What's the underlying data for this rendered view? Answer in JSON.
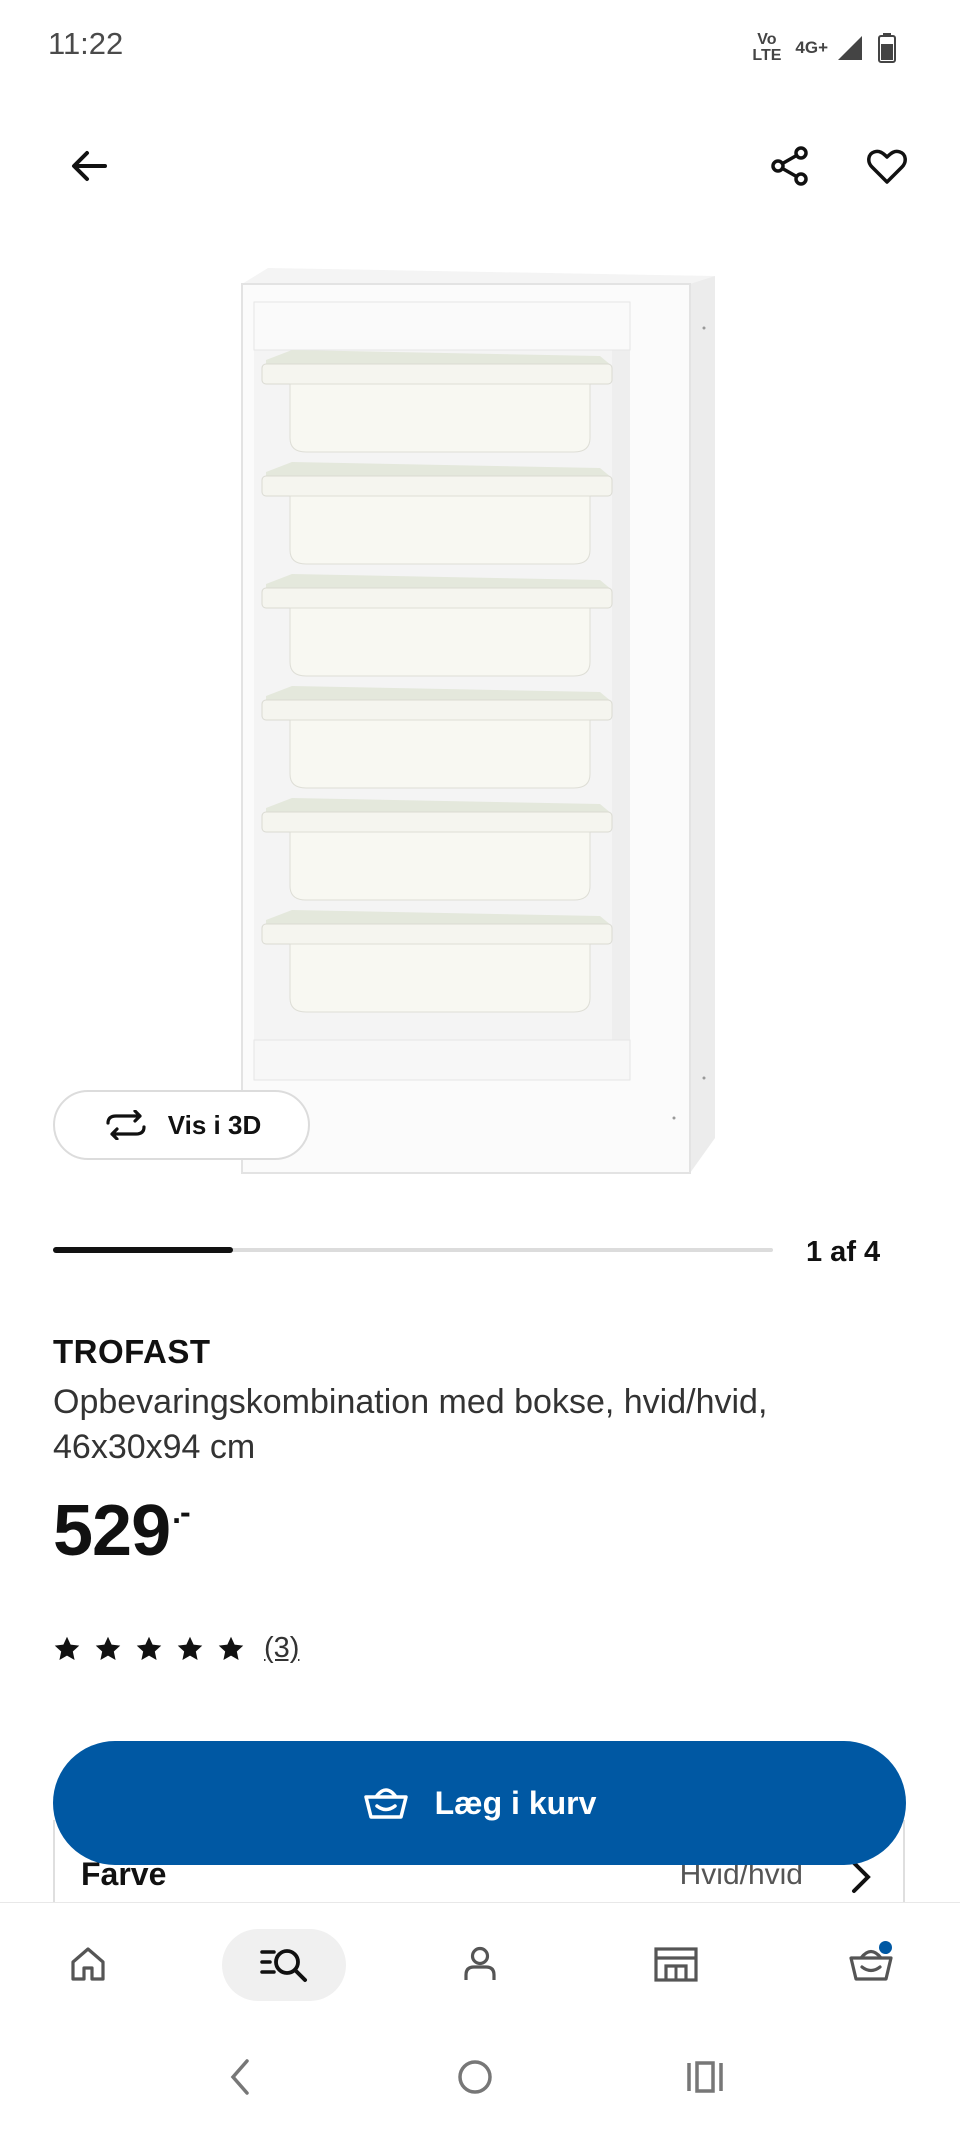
{
  "status_bar": {
    "time": "11:22",
    "volte_top": "Vo",
    "volte_bottom": "LTE",
    "network": "4G+"
  },
  "top_bar": {
    "back_icon": "arrow-left-icon",
    "share_icon": "share-icon",
    "favourite_icon": "heart-icon"
  },
  "gallery": {
    "view_3d_label": "Vis i 3D",
    "counter": "1 af 4",
    "current": 1,
    "total": 4
  },
  "product": {
    "name": "TROFAST",
    "description": "Opbevaringskombination med bokse, hvid/hvid, 46x30x94 cm",
    "price": "529",
    "price_suffix": ".-",
    "rating": 5,
    "review_count": "(3)"
  },
  "variant": {
    "label": "Farve",
    "value": "Hvid/hvid"
  },
  "cta": {
    "add_to_cart_label": "Læg i kurv",
    "color": "#0058a3"
  },
  "bottom_nav": {
    "items": [
      "home-icon",
      "search-icon",
      "account-icon",
      "store-icon",
      "cart-icon"
    ],
    "active": "search-icon"
  }
}
